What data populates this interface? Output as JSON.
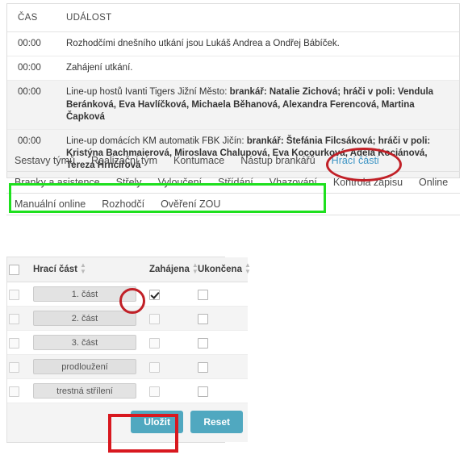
{
  "events": {
    "columns": [
      "ČAS",
      "UDÁLOST"
    ],
    "rows": [
      {
        "time": "00:00",
        "text": "Rozhodčími dnešního utkání jsou Lukáš Andrea a Ondřej Bábíček.",
        "bold_parts": []
      },
      {
        "time": "00:00",
        "text": "Zahájení utkání.",
        "bold_parts": []
      },
      {
        "time": "00:00",
        "prefix": "Line-up hostů Ivanti Tigers Jižní Město: ",
        "bold1": "brankář: Natalie Zichová; hráči v poli: Vendula Beránková, Eva Havlíčková, Michaela Běhanová, Alexandra Ferencová, Martina Čapková"
      },
      {
        "time": "00:00",
        "prefix": "Line-up domácích KM automatik FBK Jičín: ",
        "bold1": "brankář: Štefánia Filcsáková; hráči v poli: Kristýna Bachmaierová, Miroslava Chalupová, Eva Kocourková, Adéla Kociánová, Tereza Hrnčířová"
      }
    ]
  },
  "tabs": {
    "row1": [
      {
        "label": "Sestavy týmů",
        "active": false
      },
      {
        "label": "Realizační tým",
        "active": false
      },
      {
        "label": "Kontumace",
        "active": false
      },
      {
        "label": "Nástup brankářů",
        "active": false
      },
      {
        "label": "Hrací části",
        "active": true
      }
    ],
    "row2": [
      {
        "label": "Branky a asistence",
        "active": false
      },
      {
        "label": "Střely",
        "active": false
      },
      {
        "label": "Vyloučení",
        "active": false
      },
      {
        "label": "Střídání",
        "active": false
      },
      {
        "label": "Vhazování",
        "active": false
      },
      {
        "label": "Kontrola zápisu",
        "active": false
      },
      {
        "label": "Online",
        "active": false
      }
    ],
    "row3": [
      {
        "label": "Manuální online",
        "active": false
      },
      {
        "label": "Rozhodčí",
        "active": false
      },
      {
        "label": "Ověření ZOU",
        "active": false
      }
    ]
  },
  "parts_table": {
    "columns": {
      "name": "Hrací část",
      "started": "Zahájena",
      "ended": "Ukončena"
    },
    "rows": [
      {
        "name": "1. část",
        "selected": false,
        "started": true,
        "ended": false
      },
      {
        "name": "2. část",
        "selected": false,
        "started": false,
        "ended": false
      },
      {
        "name": "3. část",
        "selected": false,
        "started": false,
        "ended": false
      },
      {
        "name": "prodloužení",
        "selected": false,
        "started": false,
        "ended": false
      },
      {
        "name": "trestná střílení",
        "selected": false,
        "started": false,
        "ended": false
      }
    ],
    "save_label": "Uložit",
    "reset_label": "Reset"
  },
  "colors": {
    "accent_tab": "#3b93c4",
    "button": "#50a8c0",
    "annotation_red": "#c12027",
    "annotation_green": "#1ee01e"
  }
}
